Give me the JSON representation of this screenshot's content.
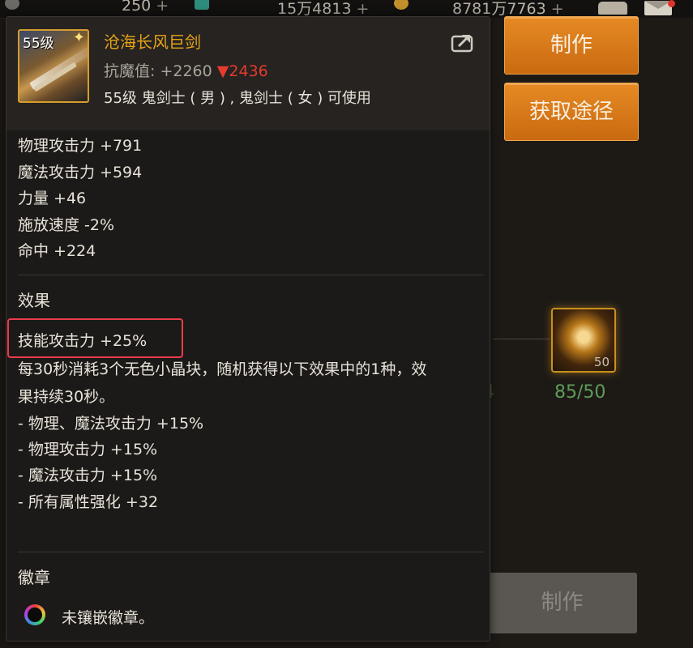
{
  "topbar": {
    "res1_value": "250",
    "res2_value": "15万4813",
    "res3_value": "8781万7763",
    "plus": "+"
  },
  "background": {
    "make_button": "制作",
    "source_button": "获取途径",
    "slot_count": "50",
    "material_count": "85/50",
    "ghost_count": "4",
    "make_button_disabled": "制作"
  },
  "tooltip": {
    "level_tag": "55级",
    "item_name": "沧海长风巨剑",
    "resist_label": "抗魔值:",
    "resist_value": "+2260",
    "resist_down_arrow": "▼",
    "resist_down_value": "2436",
    "usable_by": "55级 鬼剑士 ( 男 ) , 鬼剑士 ( 女 ) 可使用",
    "stats": [
      "物理攻击力 +791",
      "魔法攻击力 +594",
      "力量 +46",
      "施放速度 -2%",
      "命中 +224"
    ],
    "effect_title": "效果",
    "effect_main": "技能攻击力 +25%",
    "effect_desc_line1": "每30秒消耗3个无色小晶块，随机获得以下效果中的1种，效",
    "effect_desc_line2": "果持续30秒。",
    "effect_options": [
      "- 物理、魔法攻击力 +15%",
      "- 物理攻击力 +15%",
      "- 魔法攻击力 +15%",
      "- 所有属性强化 +32"
    ],
    "emblem_title": "徽章",
    "emblem_text": "未镶嵌徽章。"
  },
  "colors": {
    "accent_orange": "#e68a24",
    "name_gold": "#e6a318",
    "down_red": "#e33b30",
    "highlight_red": "#ea3c4c",
    "count_green": "#5d9c58"
  }
}
